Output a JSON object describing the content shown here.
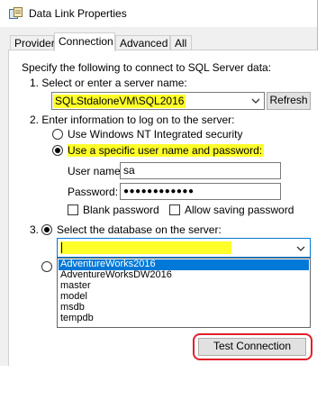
{
  "window": {
    "title": "Data Link Properties",
    "tabs": [
      "Provider",
      "Connection",
      "Advanced",
      "All"
    ],
    "active_tab": "Connection"
  },
  "connection": {
    "intro": "Specify the following to connect to SQL Server data:",
    "step1_label": "1. Select or enter a server name:",
    "server_name": "SQLStdaloneVM\\SQL2016",
    "refresh_label": "Refresh",
    "step2_label": "2. Enter information to log on to the server:",
    "windows_security_label": "Use Windows NT Integrated security",
    "specific_user_label": "Use a specific user name and password:",
    "username_label": "User name:",
    "username_value": "sa",
    "password_label": "Password:",
    "password_value": "●●●●●●●●●●●●",
    "blank_password_label": "Blank password",
    "allow_saving_label": "Allow saving password",
    "step3_label": "3.",
    "select_db_label": "Select the database on the server:",
    "database_value": "",
    "database_options": [
      "AdventureWorks2016",
      "AdventureWorksDW2016",
      "master",
      "model",
      "msdb",
      "tempdb"
    ],
    "test_connection_label": "Test Connection"
  },
  "colors": {
    "highlight": "#ffff2a",
    "selection": "#0078d7",
    "annotation_red": "#e0202a"
  }
}
